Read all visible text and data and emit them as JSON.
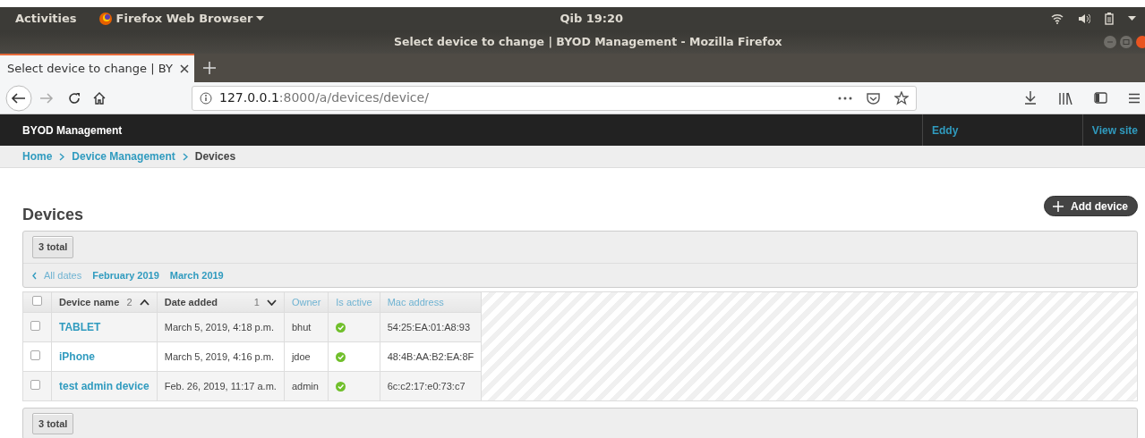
{
  "system_bar": {
    "activities": "Activities",
    "app": "Firefox Web Browser",
    "clock": "Qib 19:20"
  },
  "window": {
    "title": "Select device to change | BYOD Management - Mozilla Firefox"
  },
  "tabs": [
    {
      "label": "Select device to change | BY",
      "selected": true
    }
  ],
  "toolbar": {
    "back_disabled": false,
    "forward_disabled": true
  },
  "address_bar": {
    "host": "127.0.0.1",
    "path": ":8000/a/devices/device/"
  },
  "site": {
    "brand": "BYOD Management",
    "user": "Eddy",
    "view_site": "View site"
  },
  "breadcrumbs": [
    {
      "label": "Home",
      "link": true
    },
    {
      "label": "Device Management",
      "link": true
    },
    {
      "label": "Devices",
      "link": false
    }
  ],
  "page": {
    "title": "Devices",
    "add_button": "Add device"
  },
  "result_count": "3 total",
  "date_hierarchy": {
    "back": "All dates",
    "items": [
      "February 2019",
      "March 2019"
    ]
  },
  "table": {
    "select_all": {
      "checked": false
    },
    "columns": [
      {
        "label": "Device name",
        "sort_priority": "2",
        "sorted": true,
        "descending": false
      },
      {
        "label": "Date added",
        "sort_priority": "1",
        "sorted": true,
        "descending": true
      },
      {
        "label": "Owner",
        "sorted": false
      },
      {
        "label": "Is active",
        "sorted": false
      },
      {
        "label": "Mac address",
        "sorted": false
      }
    ],
    "rows": [
      {
        "checked": false,
        "name": "TABLET",
        "date_added": "March 5, 2019, 4:18 p.m.",
        "owner": "bhut",
        "is_active": true,
        "mac": "54:25:EA:01:A8:93"
      },
      {
        "checked": false,
        "name": "iPhone",
        "date_added": "March 5, 2019, 4:16 p.m.",
        "owner": "jdoe",
        "is_active": true,
        "mac": "48:4B:AA:B2:EA:8F"
      },
      {
        "checked": false,
        "name": "test admin device",
        "date_added": "Feb. 26, 2019, 11:17 a.m.",
        "owner": "admin",
        "is_active": true,
        "mac": "6c:c2:17:e0:73:c7"
      }
    ]
  },
  "footer_count": "3 total"
}
